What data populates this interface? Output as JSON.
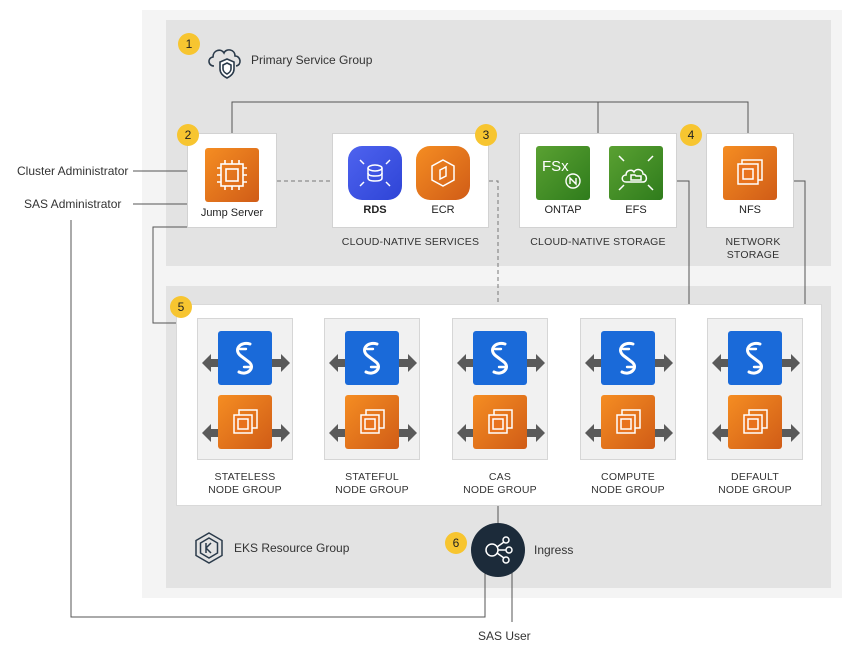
{
  "actors": {
    "cluster_admin": "Cluster Administrator",
    "sas_admin": "SAS Administrator",
    "sas_user": "SAS User"
  },
  "primary_group": {
    "badge": "1",
    "title": "Primary Service Group"
  },
  "jump_server": {
    "badge": "2",
    "label": "Jump Server"
  },
  "cloud_native_services": {
    "badge": "3",
    "caption": "CLOUD-NATIVE SERVICES",
    "items": [
      "RDS",
      "ECR"
    ]
  },
  "cloud_native_storage": {
    "caption": "CLOUD-NATIVE STORAGE",
    "items": [
      "ONTAP",
      "EFS"
    ]
  },
  "network_storage": {
    "badge": "4",
    "label": "NFS",
    "caption_line1": "NETWORK",
    "caption_line2": "STORAGE"
  },
  "node_groups": {
    "badge": "5",
    "items": [
      {
        "line1": "STATELESS",
        "line2": "NODE GROUP"
      },
      {
        "line1": "STATEFUL",
        "line2": "NODE GROUP"
      },
      {
        "line1": "CAS",
        "line2": "NODE GROUP"
      },
      {
        "line1": "COMPUTE",
        "line2": "NODE GROUP"
      },
      {
        "line1": "DEFAULT",
        "line2": "NODE GROUP"
      }
    ]
  },
  "eks_group": {
    "title": "EKS Resource Group"
  },
  "ingress": {
    "badge": "6",
    "label": "Ingress"
  },
  "fsx_logo_text": "FSx",
  "colors": {
    "aws_orange": "#e8731e",
    "sas_blue": "#1a6ad9",
    "badge_yellow": "#f7c530",
    "ingress_dark": "#1c2b3a"
  }
}
